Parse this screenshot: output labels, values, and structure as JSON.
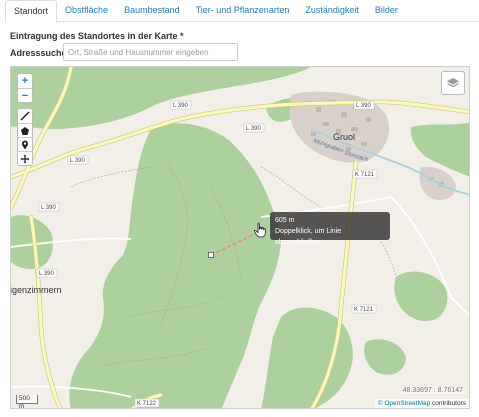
{
  "tabs": [
    {
      "label": "Standort",
      "active": true
    },
    {
      "label": "Obstfläche",
      "active": false
    },
    {
      "label": "Baumbestand",
      "active": false
    },
    {
      "label": "Tier- und Pflanzenarten",
      "active": false
    },
    {
      "label": "Zuständigkeit",
      "active": false
    },
    {
      "label": "Bilder",
      "active": false
    }
  ],
  "section_title": "Eintragung des Standortes in der Karte *",
  "address": {
    "label": "Adresssuche",
    "placeholder": "Ort, Straße und Hausnummer eingeben",
    "value": ""
  },
  "map": {
    "zoom_in": "+",
    "zoom_out": "−",
    "tools": [
      "line-draw-icon",
      "polygon-draw-icon",
      "marker-icon",
      "move-icon"
    ],
    "layers_icon": "layers-icon",
    "tooltip": {
      "distance": "605 m",
      "hint": "Doppelklick, um Linie abzuschließen"
    },
    "coordinates": "48.33697 : 8.76147",
    "attribution_link": "© OpenStreetMap",
    "attribution_suffix": " contributors",
    "scale": "500 m",
    "places": {
      "gruol": "Gruol",
      "village_sw": "igenzimmern",
      "river": "Stunzach",
      "river2": "Mühlgraben"
    },
    "roads": {
      "l390_a": "L 390",
      "l390_b": "L 390",
      "l390_c": "L 390",
      "l390_d": "L 390",
      "l390_e": "L 390",
      "l390_f": "L 390",
      "k7121_a": "K 7121",
      "k7121_b": "K 7121",
      "k7122": "K 7122"
    },
    "colors": {
      "forest": "#add19e",
      "land": "#f2efe9",
      "road_yellow": "#f7fabf",
      "built": "#d9d0c9",
      "water": "#aad3df"
    }
  }
}
